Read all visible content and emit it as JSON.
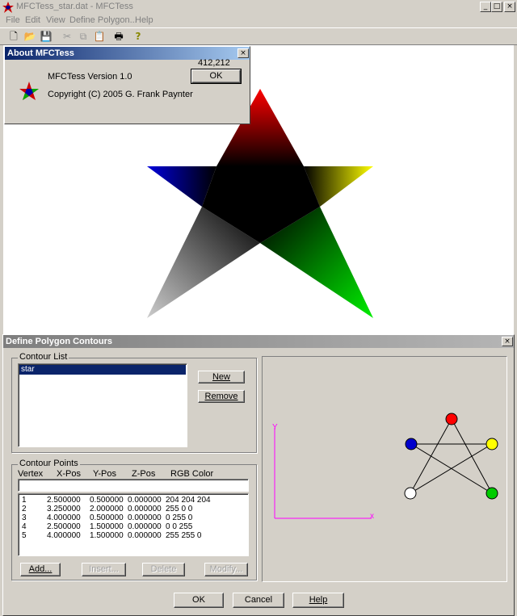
{
  "window": {
    "title": "MFCTess_star.dat - MFCTess",
    "min": "_",
    "max": "□",
    "close": "×"
  },
  "menu": [
    "File",
    "Edit",
    "View",
    "Define Polygon...",
    "Help"
  ],
  "toolbar": [
    {
      "icon": "new-file-icon",
      "glyph": "🗋"
    },
    {
      "icon": "open-folder-icon",
      "glyph": "📂"
    },
    {
      "icon": "save-icon",
      "glyph": "💾"
    },
    {
      "icon": "cut-icon",
      "glyph": "✂"
    },
    {
      "icon": "copy-icon",
      "glyph": "⧉"
    },
    {
      "icon": "paste-icon",
      "glyph": "📋"
    },
    {
      "icon": "print-icon",
      "glyph": "🖶"
    },
    {
      "icon": "help-icon",
      "glyph": "?"
    }
  ],
  "coords": "412,212",
  "about": {
    "title": "About MFCTess",
    "version": "MFCTess Version 1.0",
    "copyright": "Copyright (C) 2005 G. Frank Paynter",
    "ok": "OK",
    "close": "×"
  },
  "define": {
    "title": "Define Polygon Contours",
    "close": "×",
    "contour_list_label": "Contour List",
    "contours": [
      "star"
    ],
    "new_btn": "New",
    "remove_btn": "Remove",
    "points_label": "Contour Points",
    "columns": [
      "Vertex",
      "X-Pos",
      "Y-Pos",
      "Z-Pos",
      "RGB Color"
    ],
    "points": [
      {
        "v": "1",
        "x": "2.500000",
        "y": "0.500000",
        "z": "0.000000",
        "rgb": "204  204  204"
      },
      {
        "v": "2",
        "x": "3.250000",
        "y": "2.000000",
        "z": "0.000000",
        "rgb": "255  0  0"
      },
      {
        "v": "3",
        "x": "4.000000",
        "y": "0.500000",
        "z": "0.000000",
        "rgb": "0  255  0"
      },
      {
        "v": "4",
        "x": "2.500000",
        "y": "1.500000",
        "z": "0.000000",
        "rgb": "0  0  255"
      },
      {
        "v": "5",
        "x": "4.000000",
        "y": "1.500000",
        "z": "0.000000",
        "rgb": "255  255  0"
      }
    ],
    "add_btn": "Add...",
    "insert_btn": "Insert...",
    "delete_btn": "Delete",
    "modify_btn": "Modify...",
    "axis_x": "x",
    "axis_y": "Y",
    "ok_btn": "OK",
    "cancel_btn": "Cancel",
    "help_btn": "Help"
  },
  "colors": {
    "red": "#ff0000",
    "green": "#00cc00",
    "blue": "#0000cc",
    "yellow": "#ffff00",
    "white": "#ffffff",
    "axis": "#ff00ff",
    "selection": "#0a246a"
  }
}
